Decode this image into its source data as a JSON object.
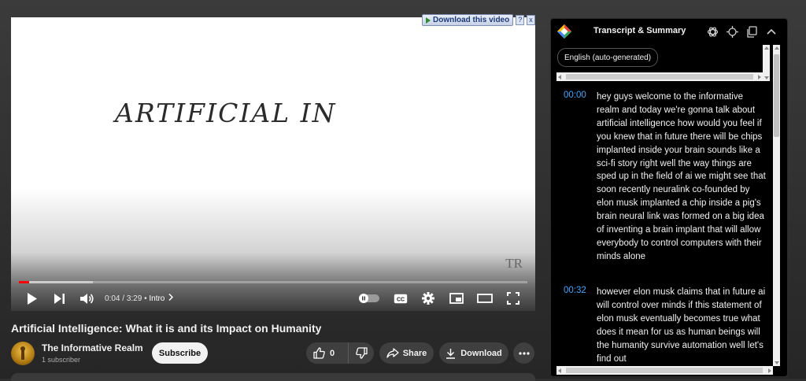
{
  "video": {
    "overlay_text": "ARTIFICIAL IN",
    "watermark": "TR",
    "download_label": "Download this video",
    "download_help": "?",
    "download_close": "x",
    "progress": 0.02,
    "buffered": 0.145,
    "time_current": "0:04",
    "time_total": "3:29",
    "time_separator": "/",
    "chapter": "Intro"
  },
  "title": "Artificial Intelligence: What it is and its Impact on Humanity",
  "channel": {
    "name": "The Informative Realm",
    "subscribers": "1 subscriber",
    "subscribe_label": "Subscribe"
  },
  "actions": {
    "like_count": "0",
    "share_label": "Share",
    "download_label": "Download"
  },
  "panel": {
    "title": "Transcript & Summary",
    "language": "English (auto-generated)",
    "segments": [
      {
        "time": "00:00",
        "text": "hey guys welcome to the informative realm and today we're gonna talk about artificial intelligence how would you feel if you knew that in future there will be chips implanted inside your brain sounds like a sci-fi story right well the way things are sped up in the field of ai we might see that soon recently neuralink co-founded by elon musk implanted a chip inside a pig's brain neural link was formed on a big idea of inventing a brain implant that will allow everybody to control computers with their minds alone"
      },
      {
        "time": "00:32",
        "text": "however elon musk claims that in future ai will control over minds if this statement of elon musk eventually becomes true what does it mean for us as human beings will the humanity survive automation well let's find out"
      }
    ]
  },
  "colors": {
    "accent_blue": "#3ea6ff",
    "progress_red": "#ff0000",
    "panel_bg": "#000000",
    "pill_bg": "#3f3f3f"
  }
}
